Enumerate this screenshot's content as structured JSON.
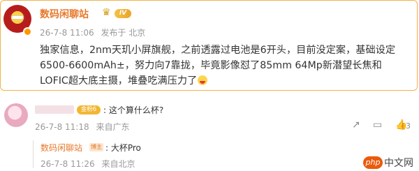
{
  "post": {
    "author": "数码闲聊站",
    "level": "IV",
    "time": "26-7-8 11:06",
    "source": "发布于 北京",
    "text": "独家信息，2nm天玑小屏旗舰，之前透露过电池是6开头，目前没定案，基础设定6500-6600mAh±，努力向7靠拢，毕竟影像怼了85mm 64Mp新潜望长焦和LOFIC超大底主摄，堆叠吃满压力了"
  },
  "comment": {
    "badge": "金粉6",
    "text": ": 这个算什么杯?",
    "time": "26-7-8 11:18",
    "source": "来自广东",
    "likes": "3",
    "actions": {
      "share": "↗",
      "comment": "▭",
      "like": "👍"
    }
  },
  "reply": {
    "author": "数码闲聊站",
    "tag": "博主",
    "text": ": 大杯Pro",
    "time": "26-7-8 11:26",
    "source": "来自北京"
  },
  "watermark": {
    "logo": "php",
    "text": "中文网"
  },
  "colors": {
    "accent": "#e8782a",
    "border": "#f0b24a",
    "meta": "#999999"
  }
}
